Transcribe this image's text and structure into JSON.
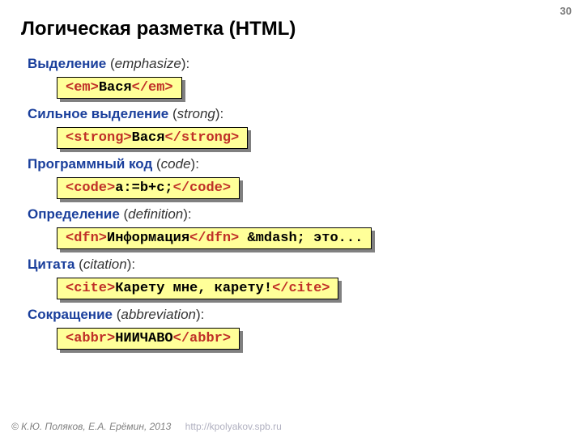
{
  "pageNumber": "30",
  "title": "Логическая разметка (HTML)",
  "items": [
    {
      "ru": "Выделение",
      "en": "emphasize",
      "open": "<em>",
      "body": "Вася",
      "close": "</em>"
    },
    {
      "ru": "Сильное выделение",
      "en": "strong",
      "open": "<strong>",
      "body": "Вася",
      "close": "</strong>"
    },
    {
      "ru": "Программный код",
      "en": "code",
      "open": "<code>",
      "body": "a:=b+c;",
      "close": "</code>"
    },
    {
      "ru": "Определение",
      "en": "definition",
      "open": "<dfn>",
      "body": "Информация",
      "close": "</dfn>",
      "after": " &mdash; это..."
    },
    {
      "ru": "Цитата",
      "en": "citation",
      "open": "<cite>",
      "body": "Карету мне, карету!",
      "close": "</cite>"
    },
    {
      "ru": "Сокращение",
      "en": "abbreviation",
      "open": "<abbr>",
      "body": "НИИЧАВО",
      "close": "</abbr>"
    }
  ],
  "footer": {
    "copyright": "© К.Ю. Поляков, Е.А. Ерёмин, 2013",
    "url": "http://kpolyakov.spb.ru"
  }
}
